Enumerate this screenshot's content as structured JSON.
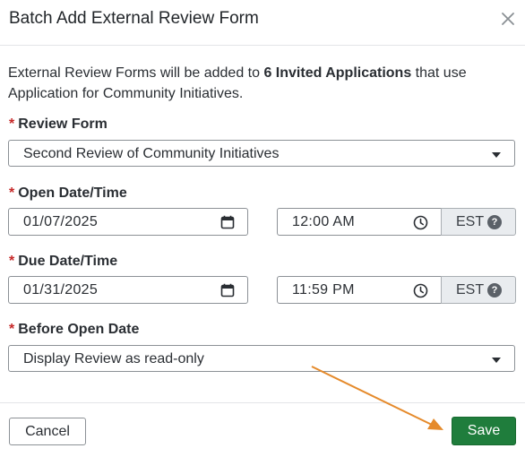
{
  "modal": {
    "title": "Batch Add External Review Form",
    "intro": {
      "prefix": "External Review Forms will be added to ",
      "bold": "6 Invited Applications",
      "suffix": " that use Application for Community Initiatives."
    }
  },
  "fields": {
    "required_mark": "*",
    "review_form": {
      "label": "Review Form",
      "value": "Second Review of Community Initiatives"
    },
    "open": {
      "label": "Open Date/Time",
      "date": "01/07/2025",
      "time": "12:00 AM",
      "timezone": "EST"
    },
    "due": {
      "label": "Due Date/Time",
      "date": "01/31/2025",
      "time": "11:59 PM",
      "timezone": "EST"
    },
    "before_open": {
      "label": "Before Open Date",
      "value": "Display Review as read-only"
    },
    "help_glyph": "?"
  },
  "footer": {
    "cancel_label": "Cancel",
    "save_label": "Save"
  },
  "colors": {
    "save": "#1f7d3c",
    "required": "#c62828",
    "annotation_arrow": "#e58a2b"
  },
  "icons": [
    "close-icon",
    "calendar-icon",
    "clock-icon",
    "help-icon",
    "chevron-down-icon"
  ]
}
